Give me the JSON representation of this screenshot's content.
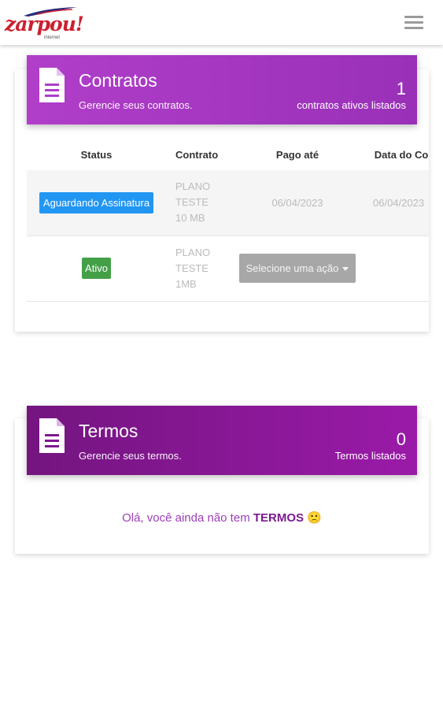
{
  "header": {
    "logo_text": "zarpou!",
    "logo_sub": "internet",
    "menu_icon": "hamburger-icon"
  },
  "contratos": {
    "title": "Contratos",
    "subtitle": "Gerencie seus contratos.",
    "count": "1",
    "count_label": "contratos ativos listados",
    "icon": "document-icon",
    "columns": [
      "Status",
      "Contrato",
      "Pago até",
      "Data do Contrato"
    ],
    "rows": [
      {
        "status": "Aguardando Assinatura",
        "plan": [
          "PLANO",
          "TESTE",
          "10 MB"
        ],
        "paid_until": "06/04/2023",
        "contract_date": "06/04/2023"
      },
      {
        "status": "Ativo",
        "plan": [
          "PLANO",
          "TESTE",
          "1MB"
        ],
        "action": "Selecione uma ação",
        "contract_date": ""
      }
    ]
  },
  "termos": {
    "title": "Termos",
    "subtitle": "Gerencie seus termos.",
    "count": "0",
    "count_label": "Termos listados",
    "icon": "document-icon",
    "empty_prefix": "Olá, você ainda não tem ",
    "empty_strong": "TERMOS",
    "empty_emoji": "🙁"
  },
  "colors": {
    "contratos_banner": "#b03ec9",
    "termos_banner": "#8a1898",
    "badge_wait": "#2196f3",
    "badge_ok": "#43a047",
    "brand_red": "#cc2030"
  }
}
